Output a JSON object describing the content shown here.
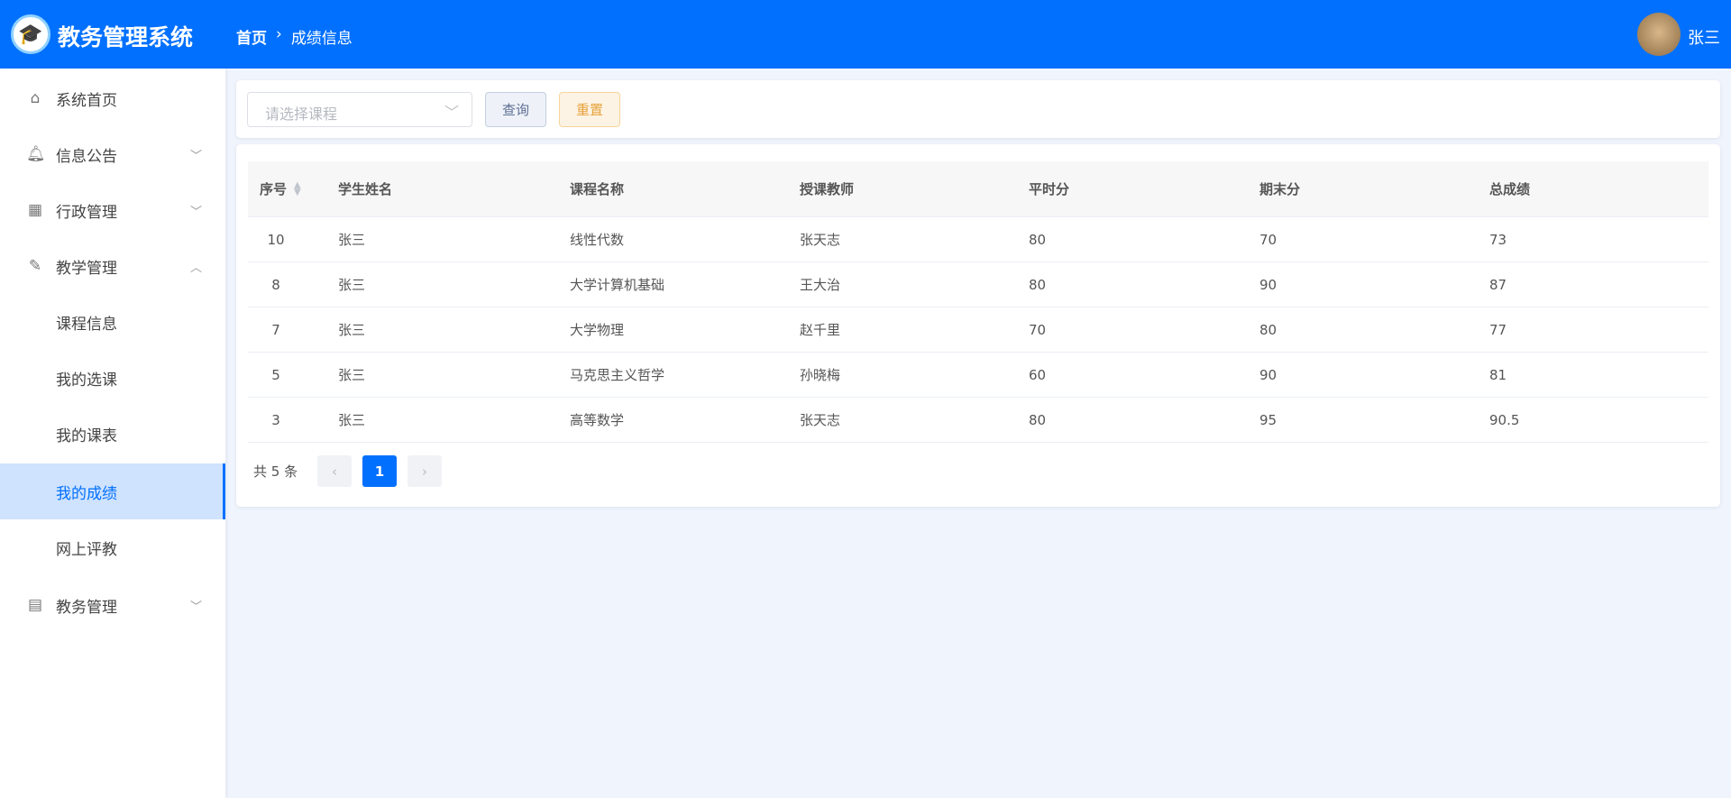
{
  "header": {
    "app_title": "教务管理系统",
    "breadcrumb": [
      "首页",
      "成绩信息"
    ],
    "user_name": "张三"
  },
  "sidebar": {
    "items": [
      {
        "label": "系统首页",
        "icon": "home-icon"
      },
      {
        "label": "信息公告",
        "icon": "bell-icon"
      },
      {
        "label": "行政管理",
        "icon": "building-icon"
      },
      {
        "label": "教学管理",
        "icon": "edit-icon"
      },
      {
        "label": "课程信息"
      },
      {
        "label": "我的选课"
      },
      {
        "label": "我的课表"
      },
      {
        "label": "我的成绩",
        "active": true
      },
      {
        "label": "网上评教"
      },
      {
        "label": "教务管理",
        "icon": "calendar-icon"
      }
    ]
  },
  "filter": {
    "course_placeholder": "请选择课程",
    "query_label": "查询",
    "reset_label": "重置"
  },
  "table": {
    "columns": [
      "序号",
      "学生姓名",
      "课程名称",
      "授课教师",
      "平时分",
      "期末分",
      "总成绩"
    ],
    "rows": [
      [
        "10",
        "张三",
        "线性代数",
        "张天志",
        "80",
        "70",
        "73"
      ],
      [
        "8",
        "张三",
        "大学计算机基础",
        "王大治",
        "80",
        "90",
        "87"
      ],
      [
        "7",
        "张三",
        "大学物理",
        "赵千里",
        "70",
        "80",
        "77"
      ],
      [
        "5",
        "张三",
        "马克思主义哲学",
        "孙晓梅",
        "60",
        "90",
        "81"
      ],
      [
        "3",
        "张三",
        "高等数学",
        "张天志",
        "80",
        "95",
        "90.5"
      ]
    ]
  },
  "pagination": {
    "total_text": "共 5 条",
    "current_page": "1"
  },
  "colors": {
    "primary": "#0170fe"
  }
}
